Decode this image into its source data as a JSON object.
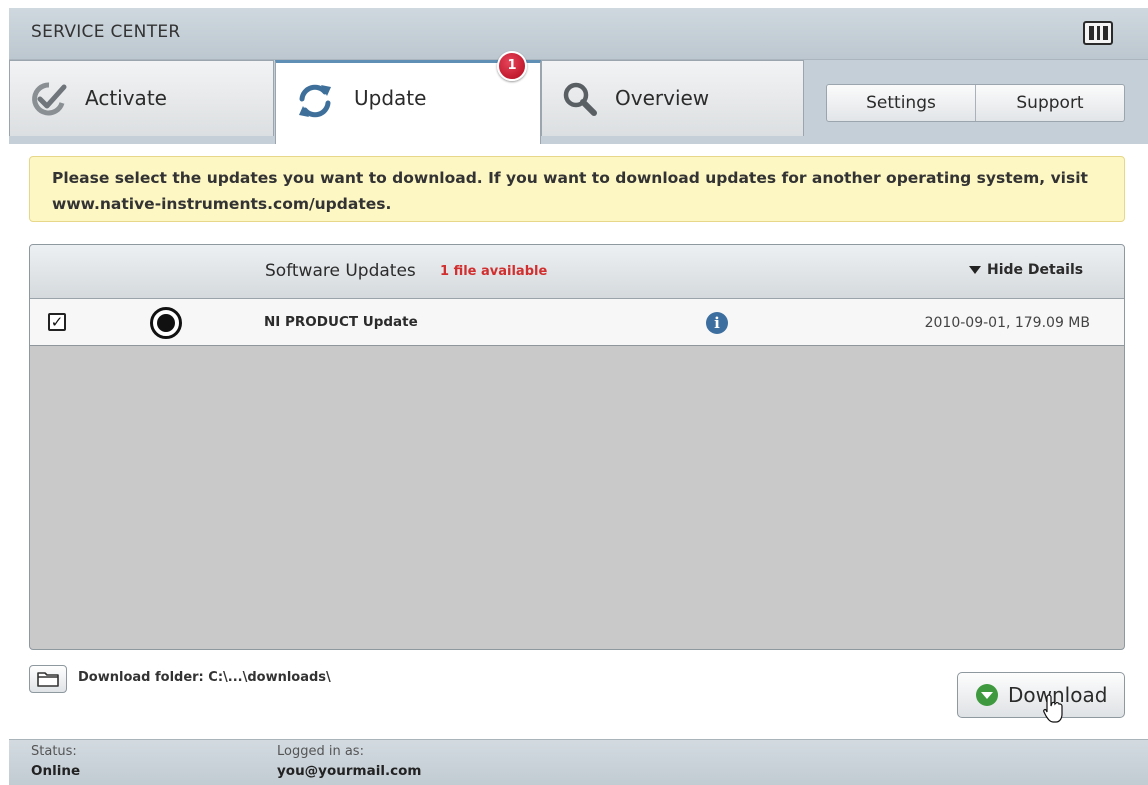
{
  "window": {
    "title": "SERVICE CENTER"
  },
  "tabs": [
    {
      "label": "Activate",
      "icon": "checkmark-badge-icon"
    },
    {
      "label": "Update",
      "icon": "refresh-icon",
      "badge": "1",
      "active": true
    },
    {
      "label": "Overview",
      "icon": "magnifier-icon"
    }
  ],
  "header_buttons": {
    "settings": "Settings",
    "support": "Support"
  },
  "notice": {
    "line1": "Please select the updates you want to download. If you want to download updates for another operating system, visit",
    "line2": "www.native-instruments.com/updates."
  },
  "updates_panel": {
    "title": "Software Updates",
    "count": "1 file available",
    "toggle": "Hide Details",
    "items": [
      {
        "checked": true,
        "name": "NI PRODUCT Update",
        "meta": "2010-09-01, 179.09 MB"
      }
    ]
  },
  "download_folder": {
    "label": "Download folder: C:\\...\\downloads\\"
  },
  "download_button": {
    "label": "Download"
  },
  "status": {
    "status_label": "Status:",
    "status_value": "Online",
    "login_label": "Logged in as:",
    "login_value": "you@yourmail.com"
  },
  "colors": {
    "accent_blue": "#5f8fb4",
    "badge_red": "#c41229",
    "count_red": "#d12f2f",
    "notice_bg": "#fdf7c4",
    "download_green": "#3f9a3f"
  }
}
